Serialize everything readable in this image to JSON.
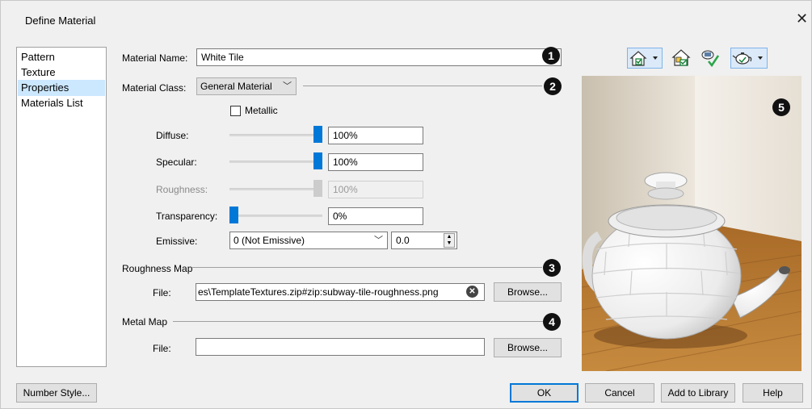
{
  "window": {
    "title": "Define Material",
    "close_glyph": "✕"
  },
  "nav": {
    "items": [
      "Pattern",
      "Texture",
      "Properties",
      "Materials List"
    ],
    "selected": "Properties"
  },
  "properties": {
    "material_name_label": "Material Name:",
    "material_name_value": "White Tile",
    "material_class_label": "Material Class:",
    "material_class_value": "General Material",
    "metallic_label": "Metallic",
    "metallic_checked": false,
    "diffuse_label": "Diffuse:",
    "diffuse_value": "100%",
    "diffuse_level": 1.0,
    "specular_label": "Specular:",
    "specular_value": "100%",
    "specular_level": 1.0,
    "roughness_label": "Roughness:",
    "roughness_value": "100%",
    "roughness_level": 1.0,
    "roughness_enabled": false,
    "transparency_label": "Transparency:",
    "transparency_value": "0%",
    "transparency_level": 0.0,
    "emissive_label": "Emissive:",
    "emissive_select": "0 (Not Emissive)",
    "emissive_value": "0.0"
  },
  "roughness_map": {
    "heading": "Roughness Map",
    "file_label": "File:",
    "file_value": "es\\TemplateTextures.zip#zip:subway-tile-roughness.png",
    "browse_label": "Browse..."
  },
  "metal_map": {
    "heading": "Metal Map",
    "file_label": "File:",
    "file_value": "",
    "browse_label": "Browse..."
  },
  "callouts": [
    "1",
    "2",
    "3",
    "4",
    "5"
  ],
  "toolbar": {
    "icons": [
      "view-options-icon",
      "wall-material-icon",
      "check-material-icon",
      "render-teapot-icon"
    ]
  },
  "footer": {
    "number_style_label": "Number Style...",
    "ok_label": "OK",
    "cancel_label": "Cancel",
    "add_to_library_label": "Add to Library",
    "help_label": "Help"
  },
  "colors": {
    "accent": "#0078d7",
    "selection": "#cce8ff",
    "wood": "#b5752d",
    "wall": "#e9e3d8"
  }
}
